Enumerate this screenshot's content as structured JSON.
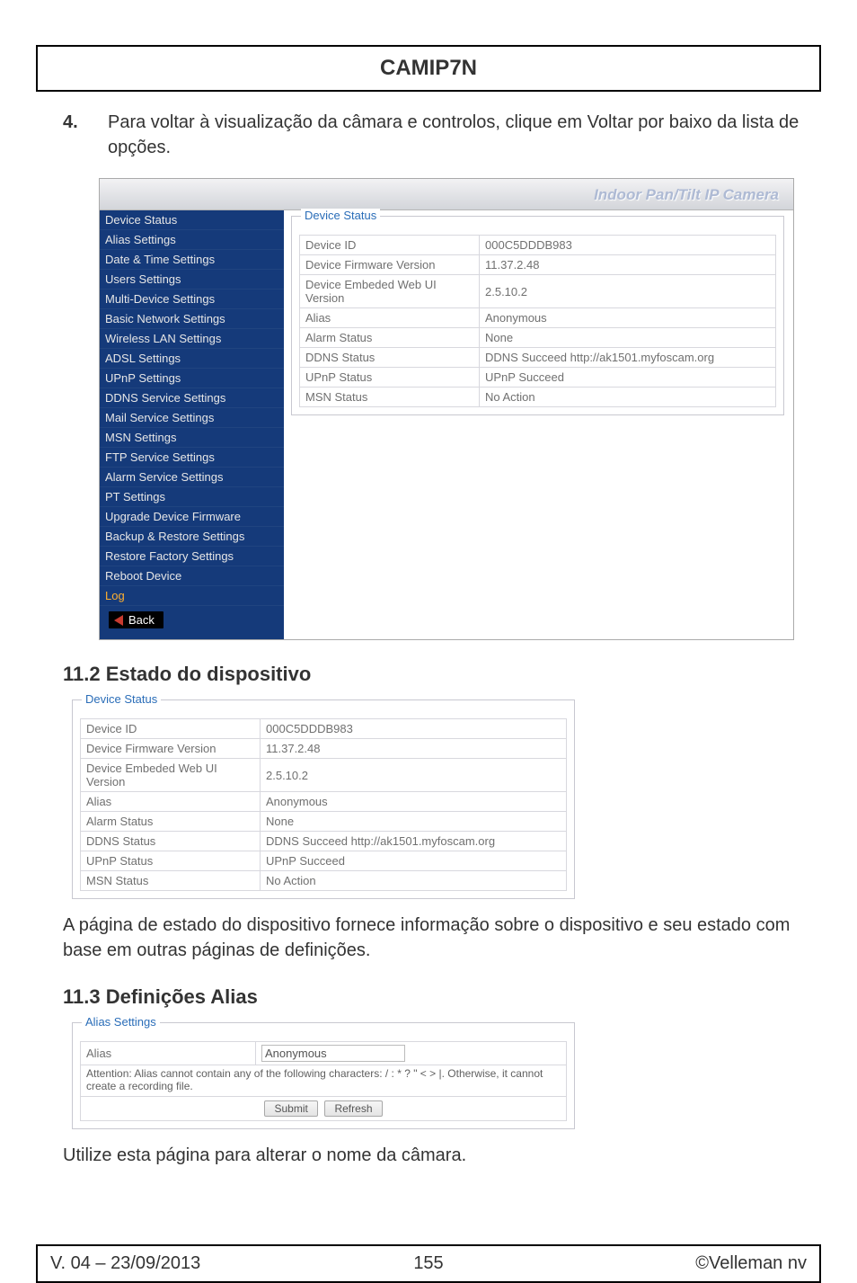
{
  "title": "CAMIP7N",
  "step": {
    "num": "4.",
    "text": "Para voltar à visualização da câmara e controlos, clique em Voltar por baixo da lista de opções."
  },
  "shot1": {
    "banner": "Indoor Pan/Tilt IP Camera",
    "sidebar": [
      "Device Status",
      "Alias Settings",
      "Date & Time Settings",
      "Users Settings",
      "Multi-Device Settings",
      "Basic Network Settings",
      "Wireless LAN Settings",
      "ADSL Settings",
      "UPnP Settings",
      "DDNS Service Settings",
      "Mail Service Settings",
      "MSN Settings",
      "FTP Service Settings",
      "Alarm Service Settings",
      "PT Settings",
      "Upgrade Device Firmware",
      "Backup & Restore Settings",
      "Restore Factory Settings",
      "Reboot Device",
      "Log"
    ],
    "back": "Back",
    "panel_title": "Device Status",
    "rows": [
      {
        "k": "Device ID",
        "v": "000C5DDDB983"
      },
      {
        "k": "Device Firmware Version",
        "v": "11.37.2.48"
      },
      {
        "k": "Device Embeded Web UI Version",
        "v": "2.5.10.2"
      },
      {
        "k": "Alias",
        "v": "Anonymous"
      },
      {
        "k": "Alarm Status",
        "v": "None"
      },
      {
        "k": "DDNS Status",
        "v": "DDNS Succeed  http://ak1501.myfoscam.org"
      },
      {
        "k": "UPnP Status",
        "v": "UPnP Succeed"
      },
      {
        "k": "MSN Status",
        "v": "No Action"
      }
    ]
  },
  "sec112": {
    "heading": "11.2   Estado do dispositivo",
    "panel_title": "Device Status",
    "rows": [
      {
        "k": "Device ID",
        "v": "000C5DDDB983"
      },
      {
        "k": "Device Firmware Version",
        "v": "11.37.2.48"
      },
      {
        "k": "Device Embeded Web UI Version",
        "v": "2.5.10.2"
      },
      {
        "k": "Alias",
        "v": "Anonymous"
      },
      {
        "k": "Alarm Status",
        "v": "None"
      },
      {
        "k": "DDNS Status",
        "v": "DDNS Succeed  http://ak1501.myfoscam.org"
      },
      {
        "k": "UPnP Status",
        "v": "UPnP Succeed"
      },
      {
        "k": "MSN Status",
        "v": "No Action"
      }
    ],
    "paragraph": "A página de estado do dispositivo fornece informação sobre o dispositivo e seu estado com base em outras páginas de definições."
  },
  "sec113": {
    "heading": "11.3   Definições Alias",
    "panel_title": "Alias Settings",
    "alias_label": "Alias",
    "alias_value": "Anonymous",
    "attention": "Attention: Alias cannot contain any of the following characters: / : * ? \" < > |. Otherwise, it cannot create a recording file.",
    "submit": "Submit",
    "refresh": "Refresh",
    "paragraph": "Utilize esta página para alterar o nome da câmara."
  },
  "footer": {
    "left": "V. 04 – 23/09/2013",
    "center": "155",
    "right": "©Velleman nv"
  }
}
